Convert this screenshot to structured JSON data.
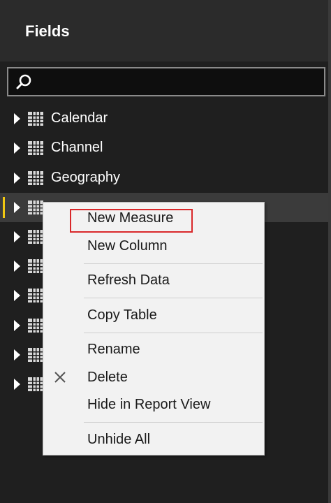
{
  "panel": {
    "title": "Fields"
  },
  "search": {
    "placeholder": "",
    "icon": "search-icon"
  },
  "fields": [
    {
      "label": "Calendar",
      "icon": "table-icon"
    },
    {
      "label": "Channel",
      "icon": "table-icon"
    },
    {
      "label": "Geography",
      "icon": "table-icon"
    },
    {
      "label": "",
      "icon": "table-icon",
      "selected": true
    },
    {
      "label": "",
      "icon": "table-icon"
    },
    {
      "label": "",
      "icon": "table-icon"
    },
    {
      "label": "",
      "icon": "table-icon"
    },
    {
      "label": "",
      "icon": "table-icon"
    },
    {
      "label": "",
      "icon": "table-icon"
    },
    {
      "label": "",
      "icon": "table-icon"
    }
  ],
  "context_menu": {
    "items": [
      {
        "label": "New Measure",
        "highlighted": true
      },
      {
        "label": "New Column"
      },
      {
        "label": "Refresh Data"
      },
      {
        "label": "Copy Table"
      },
      {
        "label": "Rename"
      },
      {
        "label": "Delete",
        "icon": "close-icon"
      },
      {
        "label": "Hide in Report View"
      },
      {
        "label": "Unhide All"
      }
    ]
  },
  "colors": {
    "panel_bg": "#1f1f1f",
    "header_bg": "#2b2b2b",
    "selected_accent": "#f2c811",
    "highlight_border": "#d9282a",
    "menu_bg": "#f2f2f2"
  }
}
